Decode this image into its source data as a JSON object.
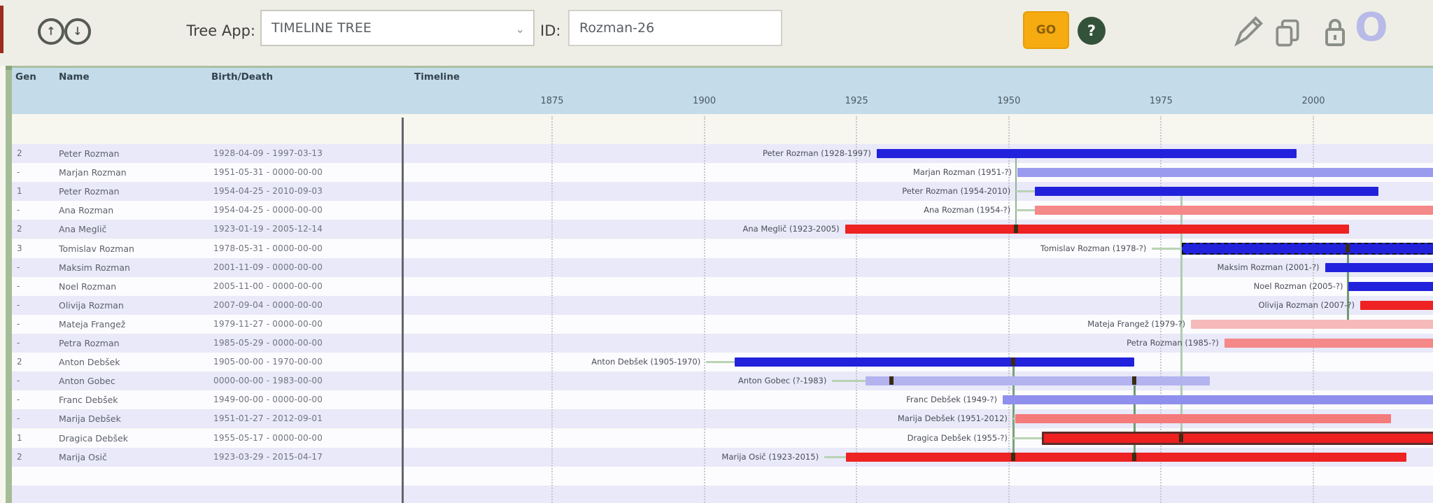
{
  "toolbar": {
    "nav_up_glyph": "↑",
    "nav_down_glyph": "↓",
    "tree_app_label": "Tree App:",
    "tree_app_value": "TIMELINE TREE",
    "select_chevron": "⌄",
    "id_label": "ID:",
    "id_value": "Rozman-26",
    "go_label": "GO",
    "help_glyph": "?",
    "avatar_label": "O"
  },
  "colors": {
    "toolbar_bg": "#efeee6",
    "header_band": "#c4dce9",
    "stripe_odd": "#e9e9f9",
    "stripe_even": "#fcfcfe",
    "go_button": "#f6ab10",
    "male_solid": "#2222dd",
    "male_faded": "#9a9aef",
    "female_solid": "#ee2222",
    "female_medium": "#f58888",
    "female_faded": "#f6baba",
    "connector_green": "#7aa37a"
  },
  "table": {
    "headers": {
      "gen": "Gen",
      "name": "Name",
      "birth_death": "Birth/Death",
      "timeline": "Timeline"
    },
    "axis_years": [
      1875,
      1900,
      1925,
      1950,
      1975,
      2000
    ],
    "rows": [
      {
        "gen": "2",
        "name": "Peter Rozman",
        "dates": "1928-04-09 - 1997-03-13",
        "label": "Peter Rozman (1928-1997)",
        "start": 1928.3,
        "end": 1997.2,
        "color": "#2222dd",
        "variant": "solid"
      },
      {
        "gen": "-",
        "name": "Marjan Rozman",
        "dates": "1951-05-31 - 0000-00-00",
        "label": "Marjan Rozman (1951-?)",
        "start": 1951.4,
        "end": "now",
        "color": "#9a9aef",
        "variant": "solid"
      },
      {
        "gen": "1",
        "name": "Peter Rozman",
        "dates": "1954-04-25 - 2010-09-03",
        "label": "Peter Rozman (1954-2010)",
        "start": 1954.3,
        "end": 2010.7,
        "color": "#2222dd",
        "variant": "solid",
        "lead": 1951.2
      },
      {
        "gen": "-",
        "name": "Ana Rozman",
        "dates": "1954-04-25 - 0000-00-00",
        "label": "Ana Rozman (1954-?)",
        "start": 1954.3,
        "end": "now",
        "color": "#f58888",
        "variant": "solid",
        "lead": 1951.2
      },
      {
        "gen": "2",
        "name": "Ana Meglič",
        "dates": "1923-01-19 - 2005-12-14",
        "label": "Ana Meglič (1923-2005)",
        "start": 1923.1,
        "end": 2005.9,
        "color": "#ee2222",
        "variant": "solid"
      },
      {
        "gen": "3",
        "name": "Tomislav Rozman",
        "dates": "1978-05-31 - 0000-00-00",
        "label": "Tomislav Rozman (1978-?)",
        "start": 1978.4,
        "end": "now",
        "color": "#2222dd",
        "variant": "dashed",
        "lead": 1973.5
      },
      {
        "gen": "-",
        "name": "Maksim Rozman",
        "dates": "2001-11-09 - 0000-00-00",
        "label": "Maksim Rozman (2001-?)",
        "start": 2001.9,
        "end": "now",
        "color": "#2222dd",
        "variant": "solid"
      },
      {
        "gen": "-",
        "name": "Noel Rozman",
        "dates": "2005-11-00 - 0000-00-00",
        "label": "Noel Rozman (2005-?)",
        "start": 2005.8,
        "end": "now",
        "color": "#2222dd",
        "variant": "solid"
      },
      {
        "gen": "-",
        "name": "Olivija Rozman",
        "dates": "2007-09-04 - 0000-00-00",
        "label": "Olivija Rozman (2007-?)",
        "start": 2007.7,
        "end": "now",
        "color": "#ee2222",
        "variant": "solid"
      },
      {
        "gen": "-",
        "name": "Mateja Frangež",
        "dates": "1979-11-27 - 0000-00-00",
        "label": "Mateja Frangež (1979-?)",
        "start": 1979.9,
        "end": "now",
        "color": "#f6baba",
        "variant": "solid"
      },
      {
        "gen": "-",
        "name": "Petra Rozman",
        "dates": "1985-05-29 - 0000-00-00",
        "label": "Petra Rozman (1985-?)",
        "start": 1985.4,
        "end": "now",
        "color": "#f58888",
        "variant": "solid"
      },
      {
        "gen": "2",
        "name": "Anton Debšek",
        "dates": "1905-00-00 - 1970-00-00",
        "label": "Anton Debšek (1905-1970)",
        "start": 1905.0,
        "end": 1970.6,
        "color": "#2222dd",
        "variant": "solid",
        "lead": 1900.3
      },
      {
        "gen": "-",
        "name": "Anton Gobec",
        "dates": "0000-00-00 - 1983-00-00",
        "label": "Anton Gobec (?-1983)",
        "start": 1926.5,
        "end": 1983.0,
        "color": "#b3b3f0",
        "variant": "solid",
        "lead": 1921.0
      },
      {
        "gen": "-",
        "name": "Franc Debšek",
        "dates": "1949-00-00 - 0000-00-00",
        "label": "Franc Debšek (1949-?)",
        "start": 1949.0,
        "end": "now",
        "color": "#8f8fee",
        "variant": "solid"
      },
      {
        "gen": "-",
        "name": "Marija Debšek",
        "dates": "1951-01-27 - 2012-09-01",
        "label": "Marija Debšek (1951-2012)",
        "start": 1951.1,
        "end": 2012.7,
        "color": "#f57a7a",
        "variant": "solid",
        "lead": 1950.7
      },
      {
        "gen": "1",
        "name": "Dragica Debšek",
        "dates": "1955-05-17 - 0000-00-00",
        "label": "Dragica Debšek (1955-?)",
        "start": 1955.4,
        "end": "now",
        "color": "#ee2020",
        "variant": "outlined",
        "lead": 1950.7
      },
      {
        "gen": "2",
        "name": "Marija Osič",
        "dates": "1923-03-29 - 2015-04-17",
        "label": "Marija Osič (1923-2015)",
        "start": 1923.2,
        "end": 2015.3,
        "color": "#ee2222",
        "variant": "solid",
        "lead": 1919.7
      }
    ]
  },
  "connectors": {
    "verticals": [
      {
        "row1": 1,
        "row2": 5,
        "year": 1951.2,
        "color": "#93b493",
        "w": 2
      },
      {
        "row1": 12,
        "row2": 17,
        "year": 1950.7,
        "color": "#7aa37a",
        "w": 3
      },
      {
        "row1": 3,
        "row2": 16,
        "year": 1978.3,
        "color": "#aecdae",
        "w": 3
      },
      {
        "row1": 6,
        "row2": 10,
        "year": 2005.6,
        "color": "#6f9a6f",
        "w": 3
      },
      {
        "row1": 13,
        "row2": 17,
        "year": 1970.6,
        "color": "#6f9a6f",
        "w": 3
      }
    ],
    "markers": [
      {
        "row": 5,
        "year": 1951.2
      },
      {
        "row": 6,
        "year": 2005.6
      },
      {
        "row": 12,
        "year": 1950.7
      },
      {
        "row": 13,
        "year": 1930.7
      },
      {
        "row": 13,
        "year": 1970.6
      },
      {
        "row": 16,
        "year": 1978.3
      },
      {
        "row": 17,
        "year": 1950.7
      },
      {
        "row": 17,
        "year": 1970.6
      }
    ]
  }
}
